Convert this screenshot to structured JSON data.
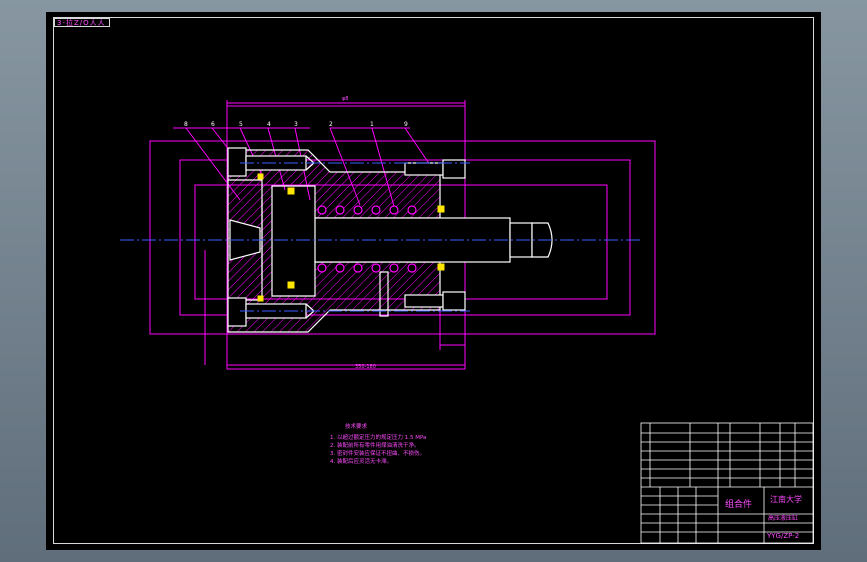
{
  "drawing": {
    "drawing_number_top": "3-拉Z/O人人",
    "drawing_number": "YYG/ZP-2",
    "assembly_label": "组合件",
    "school": "江南大学",
    "part_name": "高压液压缸",
    "tech_req_title": "技术要求",
    "tech_req_lines": [
      "1. 以超过额定压力的规定压力 1.5 MPa",
      "2. 装配前所有零件用煤油清洗干净。",
      "3. 密封件安装应保证不扭曲、不损伤。",
      "4. 装配后应灵活无卡滞。"
    ],
    "balloons": [
      "8",
      "6",
      "5",
      "4",
      "3",
      "2",
      "1",
      "9"
    ],
    "dimension_label": "φ8",
    "bottom_dimension": "350-180",
    "colors": {
      "sheet": "#000000",
      "outline": "#ffffff",
      "dimension": "#ff00ff",
      "hatch": "#ff00ff",
      "centerline": "#3b5bff",
      "seal": "#ffe600",
      "text": "#ff4cff"
    }
  }
}
